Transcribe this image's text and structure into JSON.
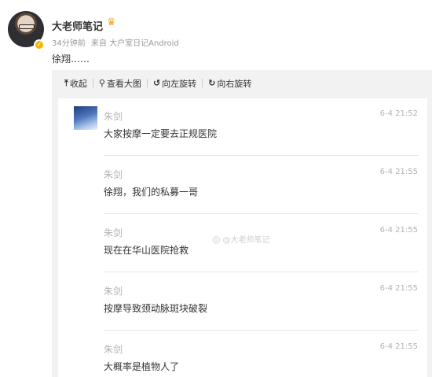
{
  "post": {
    "author": "大老师笔记",
    "time_ago": "34分钟前",
    "source": "来自 大户室日记Android",
    "text": "徐翔……"
  },
  "toolbar": {
    "collapse": "收起",
    "view_large": "查看大图",
    "rotate_left": "向左旋转",
    "rotate_right": "向右旋转"
  },
  "messages": [
    {
      "name": "朱剑",
      "time": "6-4 21:52",
      "text": "大家按摩一定要去正规医院"
    },
    {
      "name": "朱剑",
      "time": "6-4 21:55",
      "text": "徐翔，我们的私募一哥"
    },
    {
      "name": "朱剑",
      "time": "6-4 21:55",
      "text": "现在在华山医院抢救"
    },
    {
      "name": "朱剑",
      "time": "6-4 21:55",
      "text": "按摩导致颈动脉斑块破裂"
    },
    {
      "name": "朱剑",
      "time": "6-4 21:55",
      "text": "大概率是植物人了"
    }
  ],
  "watermark": "@大老师笔记",
  "icons": {
    "verified": "verified-badge-icon",
    "crown": "crown-icon",
    "collapse": "arrow-up-icon",
    "view_large": "magnifier-icon",
    "rotate_left": "rotate-left-icon",
    "rotate_right": "rotate-right-icon",
    "watermark": "weibo-logo-icon"
  }
}
